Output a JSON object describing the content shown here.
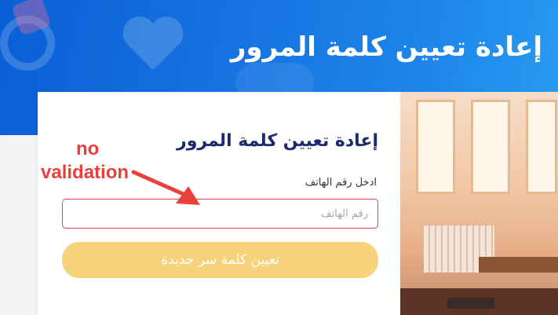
{
  "banner": {
    "title": "إعادة تعيين كلمة المرور"
  },
  "form": {
    "title": "إعادة تعيين كلمة المرور",
    "phone_label": "ادخل رقم الهاتف",
    "phone_placeholder": "رقم الهاتف",
    "phone_value": "",
    "submit_label": "تعيين كلمة سر جديدة"
  },
  "annotation": {
    "line1": "no",
    "line2": "validation"
  },
  "colors": {
    "banner": "#1672e0",
    "title": "#1a2a6c",
    "input_error_border": "#e0434d",
    "button": "#f6d27b",
    "annotation": "#e8413b"
  },
  "icons": {
    "annotation_arrow": "arrow-icon"
  }
}
